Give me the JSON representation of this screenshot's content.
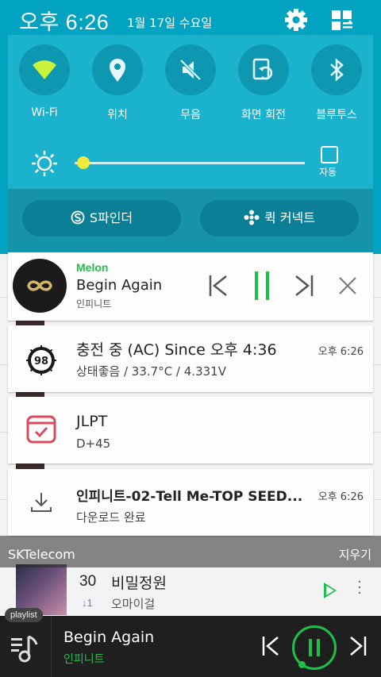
{
  "status_bar": {
    "time": "오후 6:26",
    "date": "1월 17일 수요일"
  },
  "quick_settings": {
    "toggles": [
      {
        "label": "Wi-Fi",
        "icon": "wifi-icon",
        "active": true
      },
      {
        "label": "위치",
        "icon": "location-icon",
        "active": false
      },
      {
        "label": "무음",
        "icon": "mute-icon",
        "active": false
      },
      {
        "label": "화면 회전",
        "icon": "rotate-icon",
        "active": false
      },
      {
        "label": "블루투스",
        "icon": "bluetooth-icon",
        "active": false
      }
    ],
    "brightness_level": 0.03,
    "auto_label": "자동",
    "s_finder": "S파인더",
    "quick_connect": "퀵 커넥트"
  },
  "notifications": {
    "music": {
      "app": "Melon",
      "title": "Begin Again",
      "artist": "인피니트"
    },
    "battery": {
      "badge": "98",
      "title": "충전 중 (AC) Since 오후 4:36",
      "subtitle": "상태좋음 / 33.7°C / 4.331V",
      "time": "오후 6:26"
    },
    "reminder": {
      "title": "JLPT",
      "subtitle": "D+45"
    },
    "download": {
      "title": "인피니트-02-Tell Me-TOP SEED...",
      "subtitle": "다운로드 완료",
      "time": "오후 6:26"
    }
  },
  "carrier": "SKTelecom",
  "clear_label": "지우기",
  "background_list": {
    "rank": "30",
    "rank_change": "↓1",
    "title": "비밀정원",
    "artist": "오마이걸"
  },
  "player_bar": {
    "playlist_tag": "playlist",
    "title": "Begin Again",
    "artist": "인피니트"
  },
  "colors": {
    "shade": "#02a3c0",
    "toggle_active": "#c9f23a",
    "melon_green": "#1fc04a"
  }
}
